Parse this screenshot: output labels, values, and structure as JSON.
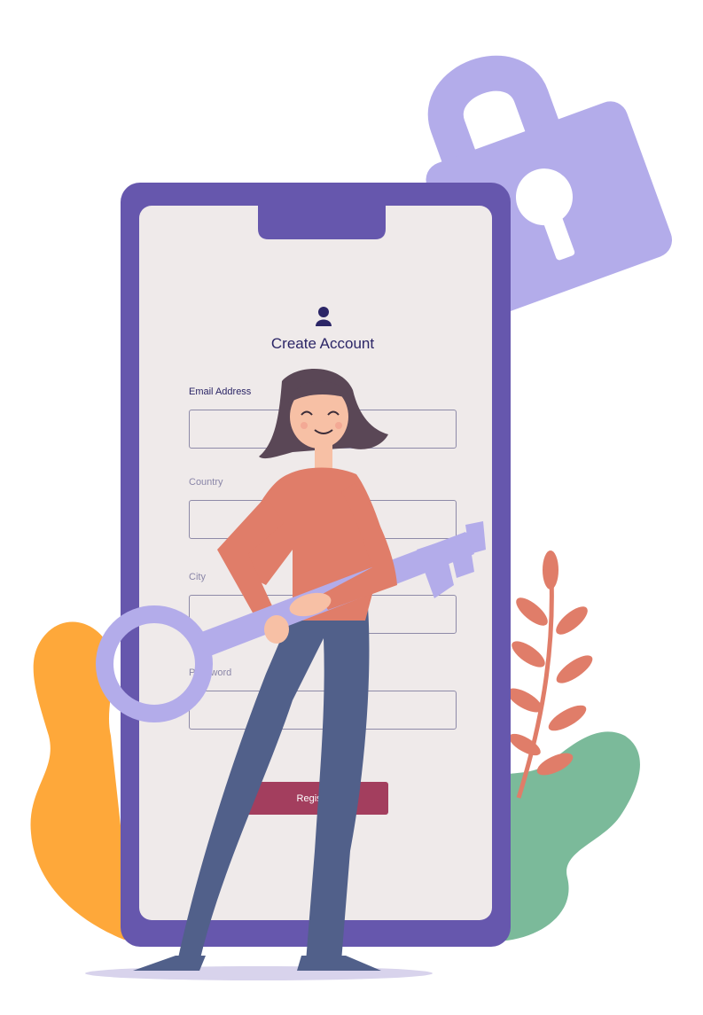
{
  "form": {
    "title": "Create Account",
    "fields": [
      {
        "label": "Email Address",
        "value": ""
      },
      {
        "label": "Country",
        "value": ""
      },
      {
        "label": "City",
        "value": ""
      },
      {
        "label": "Password",
        "value": ""
      }
    ],
    "submit_label": "Register"
  },
  "icons": [
    "lock-icon",
    "user-icon",
    "key-icon"
  ],
  "colors": {
    "phone_frame": "#6657ad",
    "screen": "#efeaea",
    "lock": "#b3acea",
    "key": "#b3acea",
    "text_dark": "#2b2566",
    "button": "#a33e5e",
    "shirt": "#e07d69",
    "pants": "#51608a",
    "hair": "#5a4756",
    "skin": "#f7c0a5",
    "orange_bush": "#fea83a",
    "green_bush": "#7bba9a",
    "leaf": "#e07d69",
    "shadow": "#d8d3ec"
  }
}
